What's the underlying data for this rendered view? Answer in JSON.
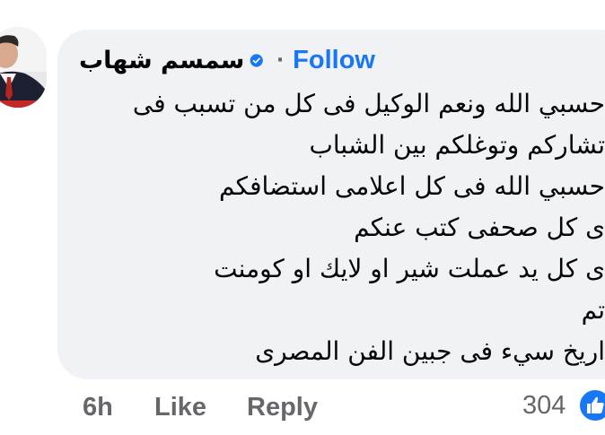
{
  "top_clip": {
    "text": "•"
  },
  "comment": {
    "author": "سمسم شهاب",
    "follow_label": "Follow",
    "separator": "·",
    "lines": [
      "حسبي الله ونعم الوكيل فى كل من تسبب فى",
      "تشاركم وتوغلكم بين الشباب",
      "حسبي الله فى كل اعلامى استضافكم",
      "ى كل صحفى كتب عنكم",
      "ى كل يد عملت شير او لايك او كومنت",
      "تم",
      "اريخ سيء فى جبين الفن المصرى"
    ]
  },
  "footer": {
    "time": "6h",
    "like_label": "Like",
    "reply_label": "Reply",
    "reaction_count": "304"
  },
  "colors": {
    "bubble": "#f0f2f5",
    "link": "#1877f2",
    "muted": "#65676b",
    "text": "#050505"
  },
  "icons": {
    "verified": "verified-badge-icon",
    "like": "like-thumb-icon"
  }
}
